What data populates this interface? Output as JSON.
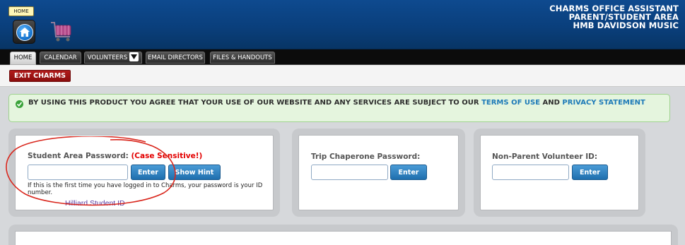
{
  "header": {
    "home_tooltip": "HOME",
    "brand_line1": "CHARMS OFFICE ASSISTANT",
    "brand_line2": "PARENT/STUDENT AREA",
    "brand_line3": "HMB DAVIDSON MUSIC"
  },
  "nav": {
    "tabs": [
      {
        "label": "HOME"
      },
      {
        "label": "CALENDAR"
      },
      {
        "label": "VOLUNTEERS"
      },
      {
        "label": "EMAIL DIRECTORS"
      },
      {
        "label": "FILES & HANDOUTS"
      }
    ]
  },
  "subbar": {
    "exit_label": "EXIT CHARMS"
  },
  "notice": {
    "text_main": "BY USING THIS PRODUCT YOU AGREE THAT YOUR USE OF OUR WEBSITE AND ANY SERVICES ARE SUBJECT TO OUR ",
    "terms_link": "TERMS OF USE",
    "and_text": " AND ",
    "privacy_link": "PRIVACY STATEMENT"
  },
  "student": {
    "label": "Student Area Password: ",
    "case_sensitive": "(Case Sensitive!)",
    "input_value": "",
    "enter_label": "Enter",
    "hint_label": "Show Hint",
    "help_text": "If this is the first time you have logged in to Charms, your password is your ID number.",
    "annotation": "Hilliard Student ID"
  },
  "chaperone": {
    "label": "Trip Chaperone Password:",
    "input_value": "",
    "enter_label": "Enter"
  },
  "volunteer": {
    "label": "Non-Parent Volunteer ID:",
    "input_value": "",
    "enter_label": "Enter"
  },
  "colors": {
    "header_blue": "#0a3f7c",
    "exit_red": "#8a0d0d",
    "button_blue": "#1f6fae",
    "notice_green": "#e5f5de",
    "annotation_red": "#d9261c",
    "link_blue": "#1d7ab8"
  },
  "icons": [
    "home-icon",
    "shopping-cart-icon",
    "dropdown-arrow-icon",
    "check-circle-icon"
  ]
}
